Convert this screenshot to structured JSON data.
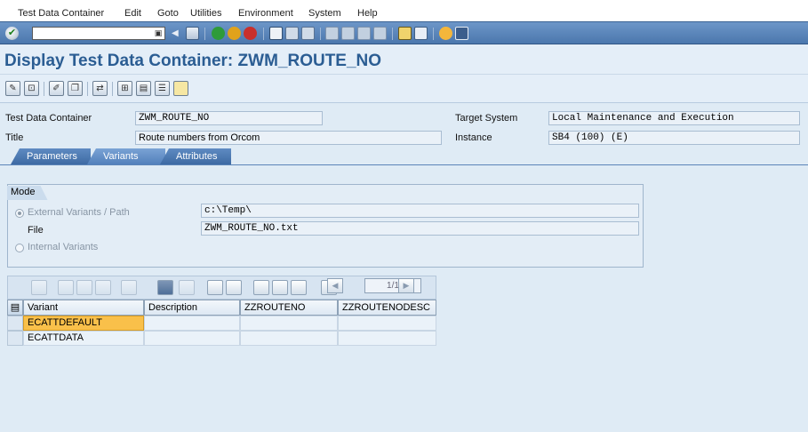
{
  "menu": [
    "Test Data Container",
    "Edit",
    "Goto",
    "Utilities",
    "Environment",
    "System",
    "Help"
  ],
  "title": "Display Test Data Container: ZWM_ROUTE_NO",
  "header": {
    "tdc_label": "Test Data Container",
    "tdc_value": "ZWM_ROUTE_NO",
    "title_label": "Title",
    "title_value": "Route numbers from Orcom",
    "target_label": "Target System",
    "target_value": "Local Maintenance and Execution",
    "instance_label": "Instance",
    "instance_value": "SB4 (100) (E)"
  },
  "tabs": [
    {
      "label": "Parameters",
      "active": false
    },
    {
      "label": "Variants",
      "active": true
    },
    {
      "label": "Attributes",
      "active": false
    }
  ],
  "mode": {
    "title": "Mode",
    "external_label": "External Variants / Path",
    "path_value": "c:\\Temp\\",
    "file_label": "File",
    "file_value": "ZWM_ROUTE_NO.txt",
    "internal_label": "Internal Variants",
    "selected": "external"
  },
  "pager": "1/1",
  "table": {
    "columns": [
      "Variant",
      "Description",
      "ZZROUTENO",
      "ZZROUTENODESC"
    ],
    "rows": [
      [
        "ECATTDEFAULT",
        "",
        "",
        ""
      ],
      [
        "ECATTDATA",
        "",
        "",
        ""
      ]
    ],
    "highlighted_cell": "ECATTDEFAULT"
  },
  "colors": {
    "title": "#2b5d93",
    "toolbar": "#4b77ad",
    "highlight": "#f9c04a",
    "background": "#dfebf5"
  }
}
